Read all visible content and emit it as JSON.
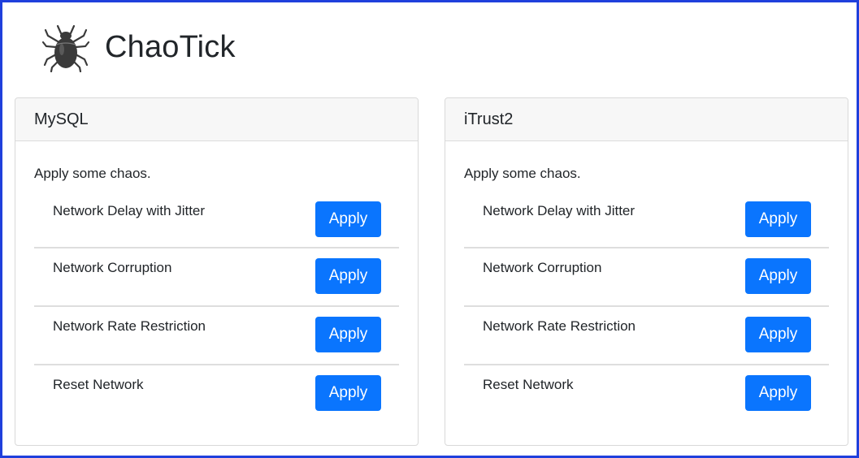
{
  "app": {
    "title": "ChaoTick",
    "logo_icon": "tick-bug-icon"
  },
  "colors": {
    "frame_border": "#1f3fdc",
    "button_bg": "#0a75fe",
    "card_header_bg": "#f7f7f7"
  },
  "cards": [
    {
      "title": "MySQL",
      "description": "Apply some chaos.",
      "actions": [
        {
          "label": "Network Delay with Jitter",
          "button": "Apply"
        },
        {
          "label": "Network Corruption",
          "button": "Apply"
        },
        {
          "label": "Network Rate Restriction",
          "button": "Apply"
        },
        {
          "label": "Reset Network",
          "button": "Apply"
        }
      ]
    },
    {
      "title": "iTrust2",
      "description": "Apply some chaos.",
      "actions": [
        {
          "label": "Network Delay with Jitter",
          "button": "Apply"
        },
        {
          "label": "Network Corruption",
          "button": "Apply"
        },
        {
          "label": "Network Rate Restriction",
          "button": "Apply"
        },
        {
          "label": "Reset Network",
          "button": "Apply"
        }
      ]
    }
  ]
}
